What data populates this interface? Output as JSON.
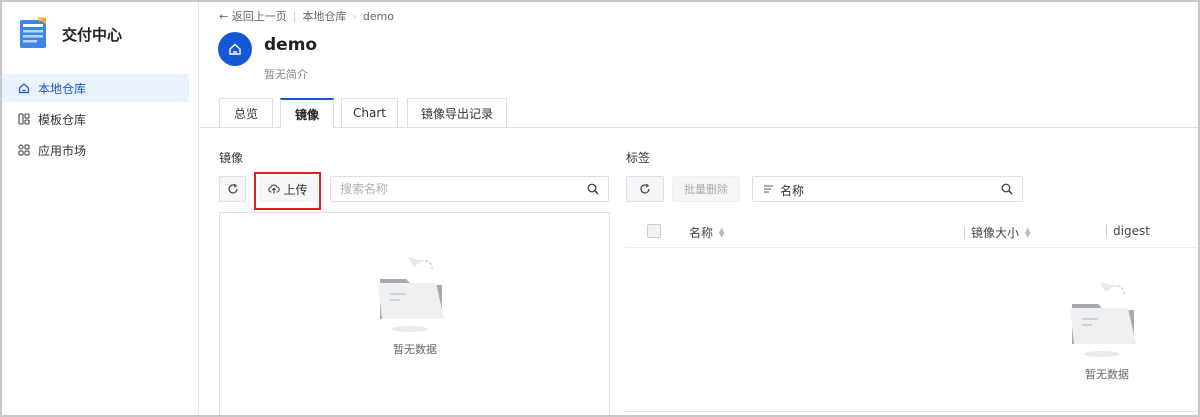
{
  "sidebar": {
    "brand_title": "交付中心",
    "items": [
      {
        "label": "本地仓库",
        "icon": "home-icon",
        "active": true
      },
      {
        "label": "模板仓库",
        "icon": "template-icon",
        "active": false
      },
      {
        "label": "应用市场",
        "icon": "apps-grid-icon",
        "active": false
      }
    ]
  },
  "breadcrumb": {
    "back": "← 返回上一页",
    "level1": "本地仓库",
    "sep": "›",
    "level2": "demo"
  },
  "repo": {
    "name": "demo",
    "description": "暂无简介"
  },
  "tabs": [
    {
      "label": "总览",
      "active": false
    },
    {
      "label": "镜像",
      "active": true
    },
    {
      "label": "Chart",
      "active": false
    },
    {
      "label": "镜像导出记录",
      "active": false
    }
  ],
  "images_panel": {
    "title": "镜像",
    "upload_label": "上传",
    "search_placeholder": "搜索名称",
    "empty_text": "暂无数据"
  },
  "tags_panel": {
    "title": "标签",
    "batch_delete_label": "批量删除",
    "filter_label": "名称",
    "columns": [
      "名称",
      "镜像大小",
      "digest"
    ],
    "empty_text": "暂无数据"
  },
  "colors": {
    "accent": "#1558d6",
    "active_nav_bg": "#e9f2fd",
    "highlight_border": "#e02020"
  }
}
